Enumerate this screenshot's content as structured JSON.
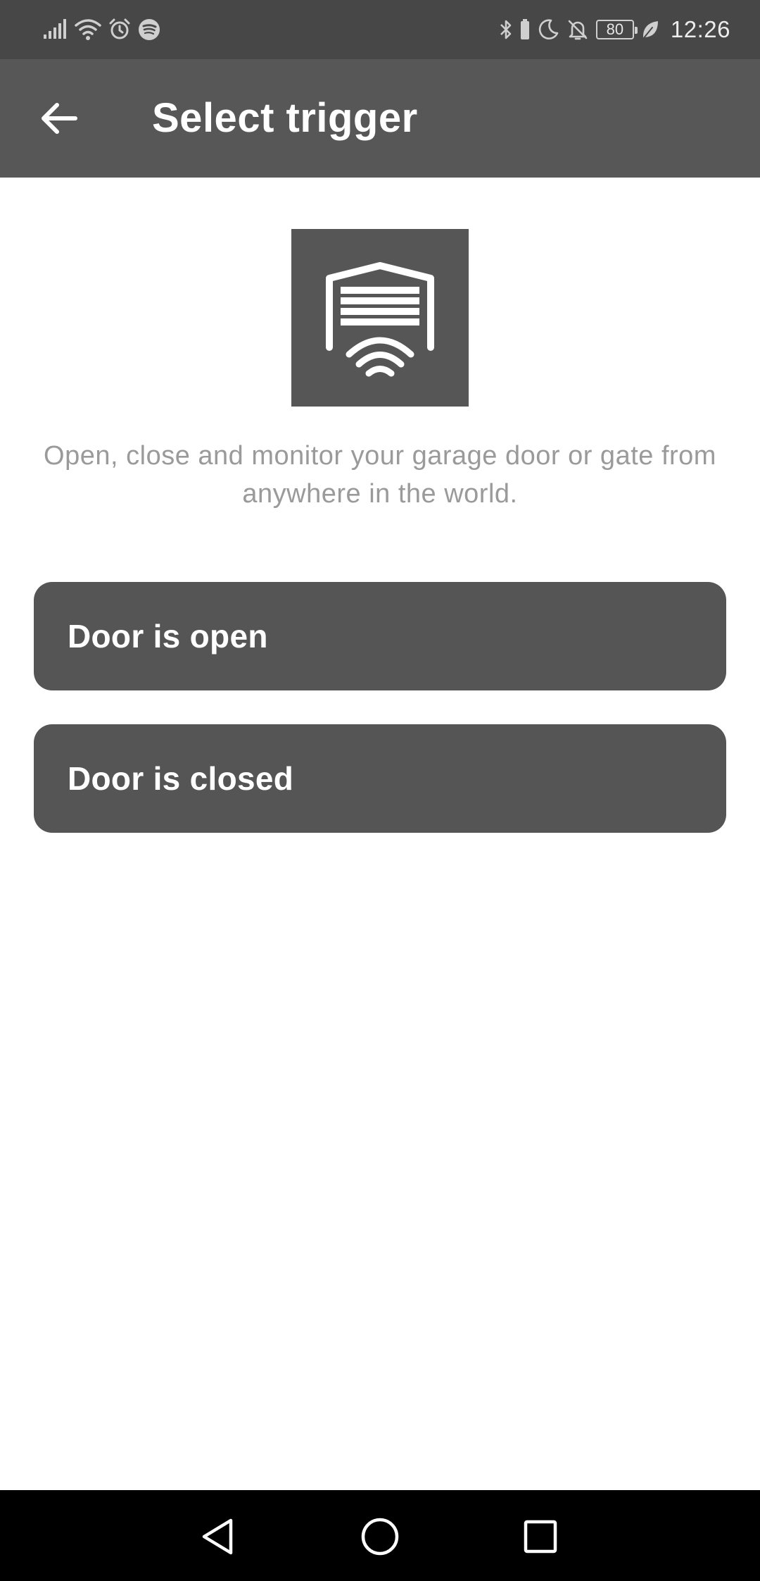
{
  "status_bar": {
    "battery_level": "80",
    "time": "12:26",
    "left_icons": [
      "signal-icon",
      "wifi-icon",
      "alarm-icon",
      "spotify-icon"
    ],
    "right_icons": [
      "bluetooth-icon",
      "battery-small-icon",
      "moon-icon",
      "bell-off-icon",
      "battery-icon",
      "leaf-icon"
    ]
  },
  "app_bar": {
    "title": "Select trigger",
    "back_icon": "arrow-left-icon"
  },
  "service": {
    "logo_icon": "garage-door-wifi-icon",
    "description": "Open, close and monitor your garage door or gate from anywhere in the world."
  },
  "triggers": [
    {
      "label": "Door is open"
    },
    {
      "label": "Door is closed"
    }
  ],
  "nav_bar": {
    "icons": [
      "back-triangle-icon",
      "home-circle-icon",
      "recents-square-icon"
    ]
  },
  "colors": {
    "status_bar_bg": "#474747",
    "app_bar_bg": "#575757",
    "button_bg": "#555555",
    "description_text": "#9a9a9a",
    "nav_bar_bg": "#000000"
  }
}
